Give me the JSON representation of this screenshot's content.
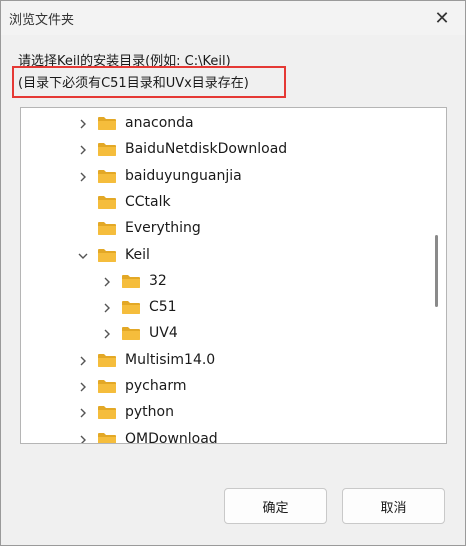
{
  "window": {
    "title": "浏览文件夹",
    "close_glyph": "✕"
  },
  "prompt": {
    "line1": "请选择Keil的安装目录(例如: C:\\Keil)",
    "line2": "(目录下必须有C51目录和UVx目录存在)"
  },
  "tree": {
    "items": [
      {
        "label": "anaconda",
        "expander": "collapsed"
      },
      {
        "label": "BaiduNetdiskDownload",
        "expander": "collapsed"
      },
      {
        "label": "baiduyunguanjia",
        "expander": "collapsed"
      },
      {
        "label": "CCtalk",
        "expander": "none"
      },
      {
        "label": "Everything",
        "expander": "none"
      },
      {
        "label": "Keil",
        "expander": "expanded"
      },
      {
        "label": "32",
        "expander": "collapsed"
      },
      {
        "label": "C51",
        "expander": "collapsed"
      },
      {
        "label": "UV4",
        "expander": "collapsed"
      },
      {
        "label": "Multisim14.0",
        "expander": "collapsed"
      },
      {
        "label": "pycharm",
        "expander": "collapsed"
      },
      {
        "label": "python",
        "expander": "collapsed"
      },
      {
        "label": "QMDownload",
        "expander": "collapsed"
      }
    ]
  },
  "buttons": {
    "ok_label": "确定",
    "cancel_label": "取消"
  },
  "colors": {
    "folder": "#f5bd3c",
    "folder_tab": "#e3a826",
    "highlight": "#e53935"
  },
  "icons": {
    "folder": "folder-icon",
    "collapsed": "chevron-right-icon",
    "expanded": "chevron-down-icon"
  }
}
